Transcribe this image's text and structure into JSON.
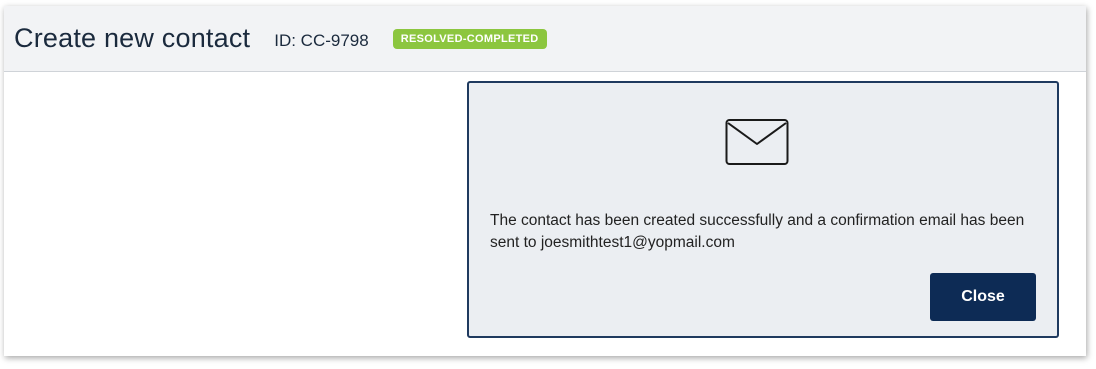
{
  "header": {
    "title": "Create new contact",
    "id_text": "ID: CC-9798",
    "status_badge": "RESOLVED-COMPLETED"
  },
  "dialog": {
    "icon": "envelope-icon",
    "message": "The contact has been created successfully and a confirmation email has been sent to joesmithtest1@yopmail.com",
    "close_label": "Close"
  },
  "colors": {
    "header_bg": "#f2f3f5",
    "title_text": "#1b2a3d",
    "badge_bg": "#8cc63f",
    "dialog_bg": "#ebeef2",
    "dialog_border": "#1f3a5f",
    "button_bg": "#0d2b55"
  }
}
